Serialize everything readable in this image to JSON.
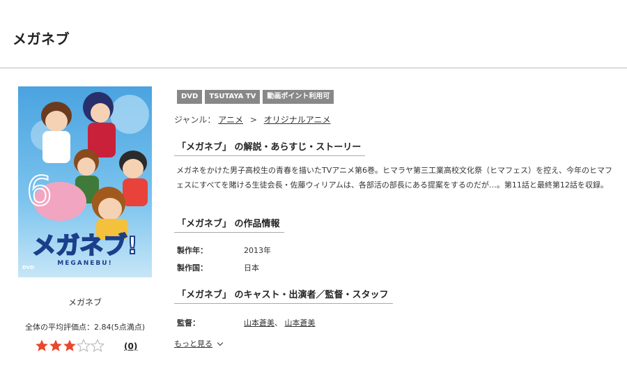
{
  "page": {
    "title": "メガネブ"
  },
  "product": {
    "jacket_logo_text": "メガネブ!",
    "jacket_logo_sub": "MEGANEBU!",
    "jacket_label": "DVD",
    "title": "メガネブ",
    "average_rating_text": "全体の平均評価点：2.84(5点満点)",
    "rating_stars": 3,
    "rating_max": 5,
    "review_count": "(0)"
  },
  "tags": [
    "DVD",
    "TSUTAYA TV",
    "動画ポイント利用可"
  ],
  "genre": {
    "label": "ジャンル：",
    "items": [
      "アニメ",
      "オリジナルアニメ"
    ],
    "separator": ">"
  },
  "sections": {
    "story_heading": "「メガネブ」 の解説・あらすじ・ストーリー",
    "story_text": "メガネをかけた男子高校生の青春を描いたTVアニメ第6巻。ヒマラヤ第三工業高校文化祭（ヒマフェス）を控え、今年のヒマフェスにすべてを賭ける生徒会長・佐藤ウィリアムは、各部活の部長にある提案をするのだが…。第11話と最終第12話を収録。",
    "info_heading": "「メガネブ」 の作品情報",
    "info_rows": [
      {
        "label": "製作年：",
        "value": "2013年"
      },
      {
        "label": "製作国：",
        "value": "日本"
      }
    ],
    "cast_heading": "「メガネブ」 のキャスト・出演者／監督・スタッフ",
    "director_label": "監督：",
    "directors": [
      "山本蒼美",
      "山本蒼美"
    ],
    "director_separator": "、",
    "more_label": "もっと見る"
  },
  "colors": {
    "star_filled": "#e8492d",
    "star_empty": "#bdbdbd",
    "tag_bg": "#888888"
  }
}
